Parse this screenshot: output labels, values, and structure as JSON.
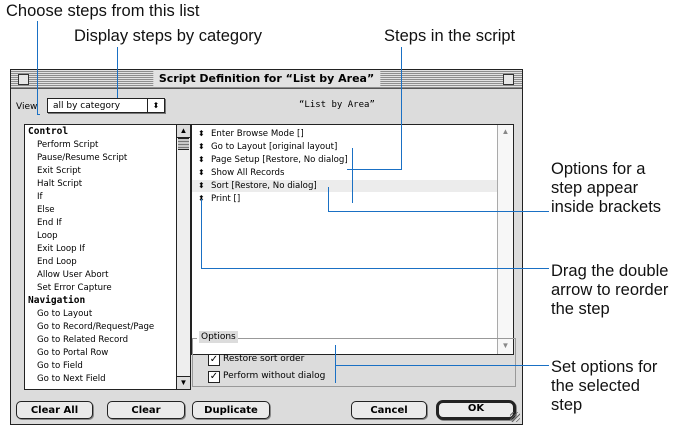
{
  "callouts": {
    "choose_steps": "Choose steps from this list",
    "display_by_category": "Display steps by category",
    "steps_in_script": "Steps in the script",
    "options_brackets": [
      "Options for a",
      "step appear",
      "inside brackets"
    ],
    "drag_arrow": [
      "Drag the double",
      "arrow to reorder",
      "the step"
    ],
    "set_options": [
      "Set options for",
      "the selected",
      "step"
    ]
  },
  "dialog": {
    "title": "Script Definition for “List by Area”",
    "view_label": "View",
    "view_selected": "all by category",
    "script_name": "“List by Area”"
  },
  "step_list": [
    {
      "type": "category",
      "label": "Control"
    },
    {
      "type": "step",
      "label": "Perform Script"
    },
    {
      "type": "step",
      "label": "Pause/Resume Script"
    },
    {
      "type": "step",
      "label": "Exit Script"
    },
    {
      "type": "step",
      "label": "Halt Script"
    },
    {
      "type": "step",
      "label": "If"
    },
    {
      "type": "step",
      "label": "Else"
    },
    {
      "type": "step",
      "label": "End If"
    },
    {
      "type": "step",
      "label": "Loop"
    },
    {
      "type": "step",
      "label": "Exit Loop If"
    },
    {
      "type": "step",
      "label": "End Loop"
    },
    {
      "type": "step",
      "label": "Allow User Abort"
    },
    {
      "type": "step",
      "label": "Set Error Capture"
    },
    {
      "type": "category",
      "label": "Navigation"
    },
    {
      "type": "step",
      "label": "Go to Layout"
    },
    {
      "type": "step",
      "label": "Go to Record/Request/Page"
    },
    {
      "type": "step",
      "label": "Go to Related Record"
    },
    {
      "type": "step",
      "label": "Go to Portal Row"
    },
    {
      "type": "step",
      "label": "Go to Field"
    },
    {
      "type": "step",
      "label": "Go to Next Field"
    }
  ],
  "script_steps": [
    {
      "text": "Enter Browse Mode []",
      "selected": false
    },
    {
      "text": "Go to Layout [original layout]",
      "selected": false
    },
    {
      "text": "Page Setup [Restore, No dialog]",
      "selected": false
    },
    {
      "text": "Show All Records",
      "selected": false
    },
    {
      "text": "Sort [Restore, No dialog]",
      "selected": true
    },
    {
      "text": "Print []",
      "selected": false
    }
  ],
  "options": {
    "label": "Options",
    "restore_sort_order": {
      "label": "Restore sort order",
      "checked": true
    },
    "perform_without_dialog": {
      "label": "Perform without dialog",
      "checked": true
    }
  },
  "buttons": {
    "clear_all": "Clear All",
    "clear": "Clear",
    "duplicate": "Duplicate",
    "cancel": "Cancel",
    "ok": "OK"
  },
  "colors": {
    "callout_line": "#1a70c4",
    "dialog_bg": "#dcdcdc",
    "selected_row": "#ececec"
  },
  "icons": [
    "close-box-icon",
    "zoom-box-icon",
    "popup-arrow-icon",
    "scroll-up-icon",
    "scroll-down-icon",
    "double-arrow-icon",
    "checkmark-icon",
    "grow-box-icon"
  ]
}
